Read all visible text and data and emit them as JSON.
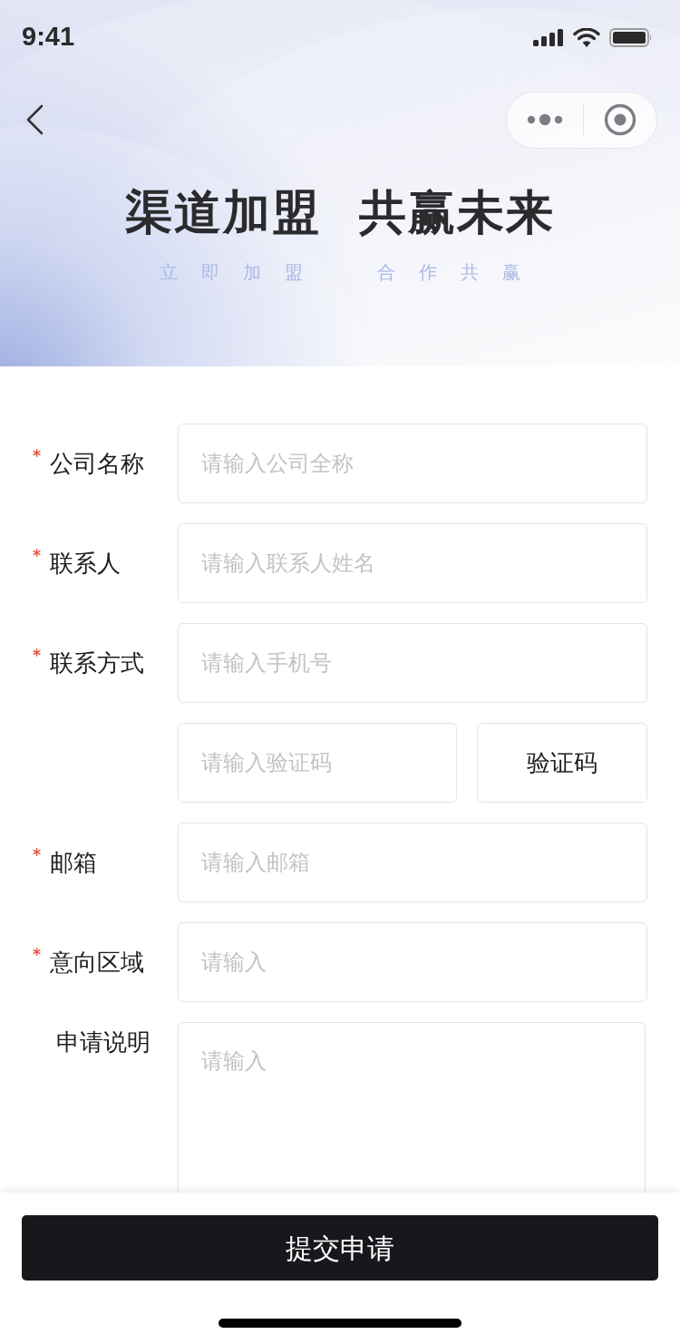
{
  "status_bar": {
    "time": "9:41"
  },
  "banner": {
    "title": "渠道加盟 共赢未来",
    "taglines": [
      "立即加盟",
      "合作共赢"
    ]
  },
  "form": {
    "fields": [
      {
        "kind": "input",
        "label": "公司名称",
        "required": true,
        "placeholder": "请输入公司全称"
      },
      {
        "kind": "input",
        "label": "联系人",
        "required": true,
        "placeholder": "请输入联系人姓名"
      },
      {
        "kind": "input",
        "label": "联系方式",
        "required": true,
        "placeholder": "请输入手机号"
      },
      {
        "kind": "code",
        "placeholder": "请输入验证码",
        "button": "验证码"
      },
      {
        "kind": "input",
        "label": "邮箱",
        "required": true,
        "placeholder": "请输入邮箱"
      },
      {
        "kind": "input",
        "label": "意向区域",
        "required": true,
        "placeholder": "请输入"
      },
      {
        "kind": "textarea",
        "label": "申请说明",
        "required": false,
        "placeholder": "请输入"
      }
    ]
  },
  "submit_button": "提交申请"
}
